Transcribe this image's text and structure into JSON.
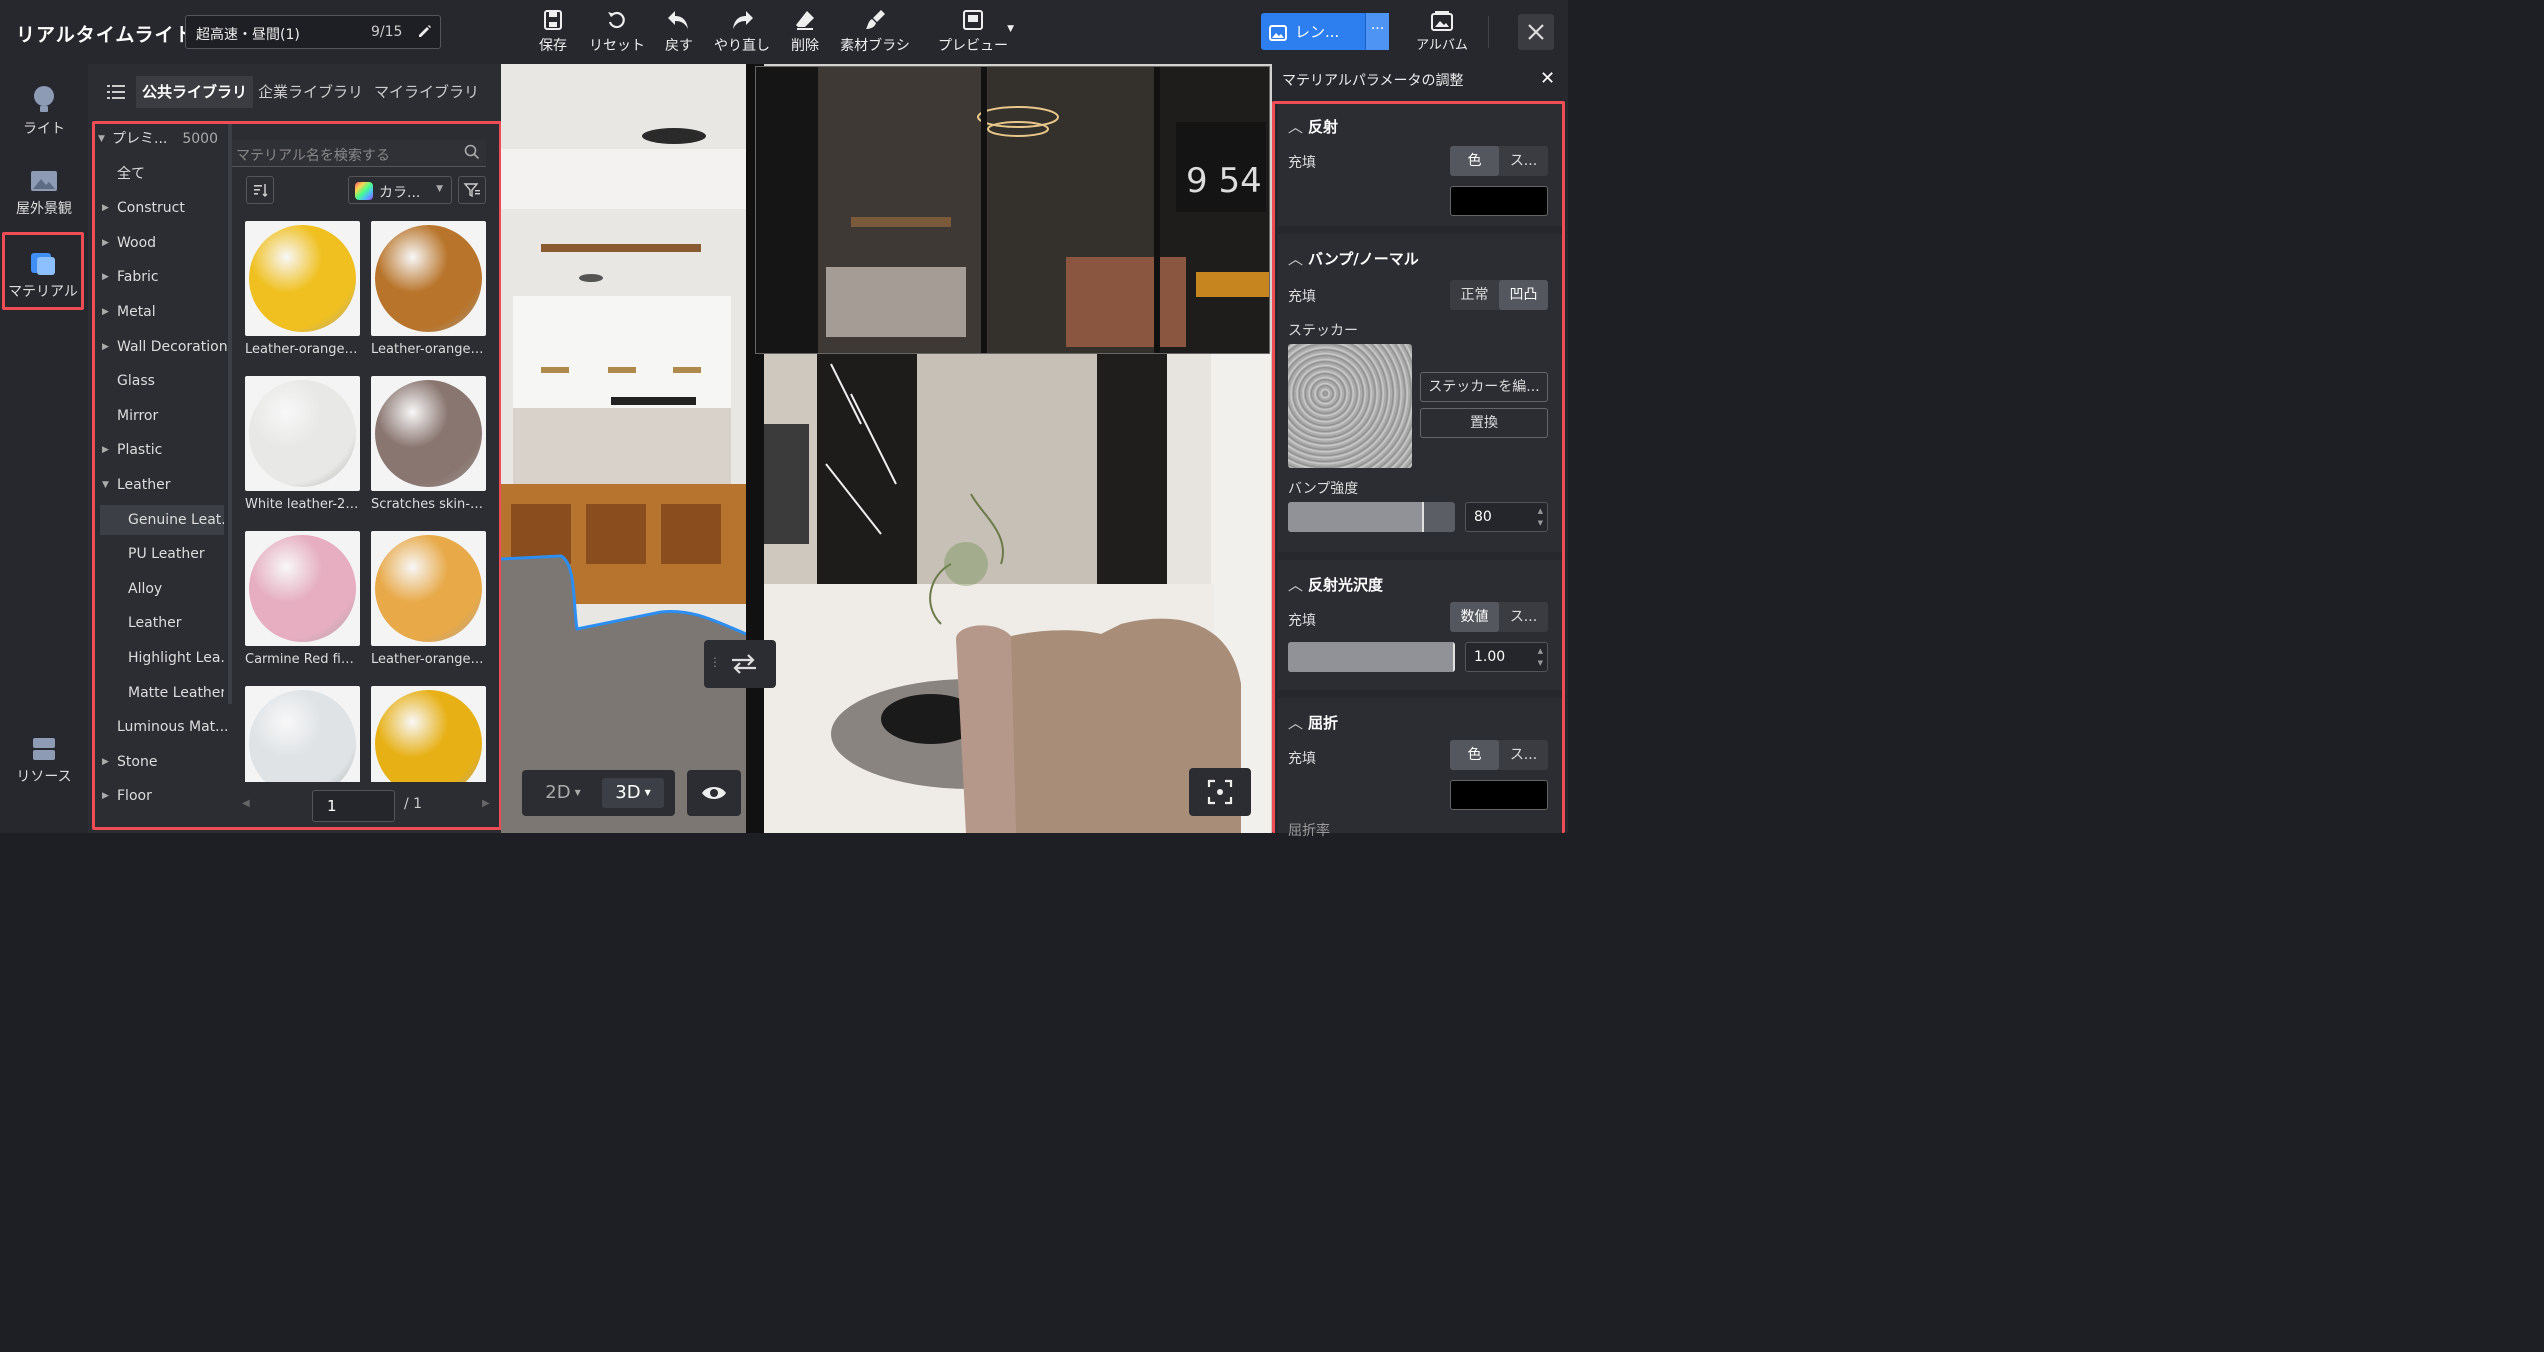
{
  "app": {
    "title": "リアルタイムライト",
    "doc_name": "超高速・昼間(1)",
    "doc_count": "9/15"
  },
  "toolbar": {
    "save": "保存",
    "reset": "リセット",
    "undo": "戻す",
    "redo": "やり直し",
    "delete": "削除",
    "material_brush": "素材ブラシ",
    "preview": "プレビュー",
    "render": "レン...",
    "render_more": "···",
    "album": "アルバム"
  },
  "leftbar": {
    "light": "ライト",
    "outdoor": "屋外景観",
    "material": "マテリアル",
    "resources": "リソース"
  },
  "library": {
    "tabs": [
      "公共ライブラリ",
      "企業ライブラリ",
      "マイライブラリ"
    ],
    "active_tab": 0,
    "search_placeholder": "マテリアル名を検索する",
    "color_filter": "カラ...",
    "categories": [
      {
        "label": "プレミ...",
        "count": "5000",
        "expanded": true,
        "level": 0
      },
      {
        "label": "全て",
        "level": 1
      },
      {
        "label": "Construct",
        "level": 1,
        "has_children": true
      },
      {
        "label": "Wood",
        "level": 1,
        "has_children": true
      },
      {
        "label": "Fabric",
        "level": 1,
        "has_children": true
      },
      {
        "label": "Metal",
        "level": 1,
        "has_children": true
      },
      {
        "label": "Wall Decoration",
        "level": 1,
        "has_children": true
      },
      {
        "label": "Glass",
        "level": 1
      },
      {
        "label": "Mirror",
        "level": 1
      },
      {
        "label": "Plastic",
        "level": 1,
        "has_children": true
      },
      {
        "label": "Leather",
        "level": 1,
        "expanded": true
      },
      {
        "label": "Genuine Leat...",
        "level": 2,
        "selected": true
      },
      {
        "label": "PU Leather",
        "level": 2
      },
      {
        "label": "Alloy",
        "level": 2
      },
      {
        "label": "Leather",
        "level": 2
      },
      {
        "label": "Highlight Lea...",
        "level": 2
      },
      {
        "label": "Matte Leather",
        "level": 2
      },
      {
        "label": "Luminous Mat...",
        "level": 1
      },
      {
        "label": "Stone",
        "level": 1,
        "has_children": true
      },
      {
        "label": "Floor",
        "level": 1,
        "has_children": true
      }
    ],
    "materials": [
      {
        "name": "Leather-orange-...",
        "color": "#f0c020"
      },
      {
        "name": "Leather-orange ...",
        "color": "#b8742a"
      },
      {
        "name": "White leather-2 ti...",
        "color": "#e8e8e6"
      },
      {
        "name": "Scratches skin-do...",
        "color": "#8a7670"
      },
      {
        "name": "Carmine Red fine...",
        "color": "#e6aec0"
      },
      {
        "name": "Leather-orange fi...",
        "color": "#e8a948"
      },
      {
        "name": "",
        "color": "#dfe3e6"
      },
      {
        "name": "",
        "color": "#e7b015"
      }
    ],
    "page": "1",
    "page_total": "/ 1"
  },
  "viewport": {
    "mode_2d": "2D",
    "mode_3d": "3D",
    "active_mode": "3D"
  },
  "panel": {
    "title": "マテリアルパラメータの調整",
    "reflection": {
      "title": "反射",
      "fill_label": "充填",
      "seg": [
        "色",
        "ス..."
      ],
      "seg_active": 0,
      "color": "#000000"
    },
    "bump": {
      "title": "バンプ/ノーマル",
      "fill_label": "充填",
      "seg": [
        "正常",
        "凹凸"
      ],
      "seg_active": 1,
      "sticker_label": "ステッカー",
      "edit_sticker": "ステッカーを編...",
      "replace": "置換",
      "strength_label": "バンプ強度",
      "strength": "80",
      "strength_fraction": 0.8
    },
    "gloss": {
      "title": "反射光沢度",
      "fill_label": "充填",
      "seg": [
        "数値",
        "ス..."
      ],
      "seg_active": 0,
      "value": "1.00",
      "fraction": 1.0
    },
    "refraction": {
      "title": "屈折",
      "fill_label": "充填",
      "seg": [
        "色",
        "ス..."
      ],
      "seg_active": 0,
      "color": "#000000",
      "next_label": "屈折率"
    }
  },
  "colors": {
    "accent": "#2d7ff0",
    "highlight_border": "#ee4d55"
  }
}
